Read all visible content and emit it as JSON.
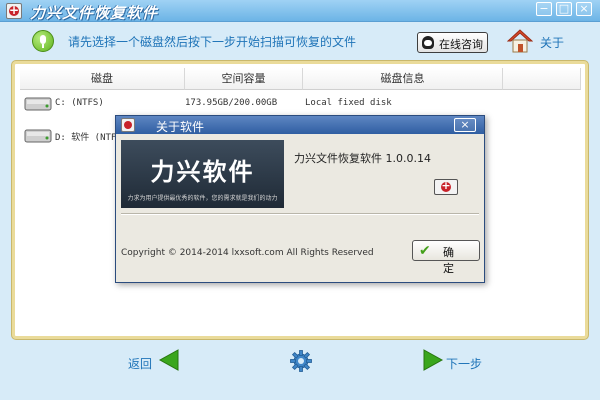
{
  "window": {
    "title": "力兴文件恢复软件",
    "controls": {
      "minimize": "−",
      "maximize": "□",
      "close": "×"
    }
  },
  "header": {
    "instruction": "请先选择一个磁盘然后按下一步开始扫描可恢复的文件",
    "consult_button": "在线咨询",
    "about_link": "关于"
  },
  "table": {
    "columns": [
      "磁盘",
      "空间容量",
      "磁盘信息"
    ],
    "rows": [
      {
        "name": "C: (NTFS)",
        "capacity": "173.95GB/200.00GB",
        "info": "Local fixed disk"
      },
      {
        "name": "D: 软件 (NTF",
        "capacity": "",
        "info": ""
      }
    ]
  },
  "footer": {
    "back_label": "返回",
    "next_label": "下一步"
  },
  "dialog": {
    "title": "关于软件",
    "close": "×",
    "banner_title": "力兴软件",
    "banner_subtitle": "力求为用户提供最优秀的软件，您的需求就是我们的动力",
    "version": "力兴文件恢复软件 1.0.0.14",
    "copyright": "Copyright © 2014-2014 lxxsoft.com All Rights Reserved",
    "ok_button": "确 定"
  },
  "icons": {
    "app": "app-logo-icon",
    "mic": "microphone-icon",
    "qq": "qq-icon",
    "home": "home-icon",
    "drive": "hard-drive-icon",
    "back": "back-arrow-icon",
    "settings": "gear-icon",
    "next": "next-arrow-icon",
    "check": "check-icon"
  },
  "colors": {
    "titlebar": "#6cb4e6",
    "accent_text": "#1f74b8",
    "panel_border": "#eadb9a",
    "dialog_titlebar": "#2f5ea2",
    "nav_arrow": "#3aa61d"
  }
}
